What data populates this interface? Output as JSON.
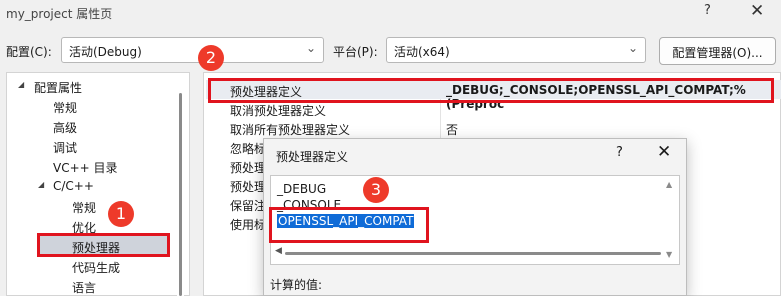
{
  "window": {
    "title": "my_project 属性页",
    "help": "?",
    "close": "✕"
  },
  "config": {
    "config_label": "配置(C):",
    "config_value": "活动(Debug)",
    "platform_label": "平台(P):",
    "platform_value": "活动(x64)",
    "manager_button": "配置管理器(O)..."
  },
  "tree": {
    "items": [
      {
        "label": "配置属性",
        "toggle": "◢"
      },
      {
        "label": "常规"
      },
      {
        "label": "高级"
      },
      {
        "label": "调试"
      },
      {
        "label": "VC++ 目录"
      },
      {
        "label": "C/C++",
        "toggle": "◢"
      },
      {
        "label": "常规"
      },
      {
        "label": "优化"
      },
      {
        "label": "预处理器"
      },
      {
        "label": "代码生成"
      },
      {
        "label": "语言"
      }
    ]
  },
  "properties": {
    "rows": [
      {
        "name": "预处理器定义",
        "value": "_DEBUG;_CONSOLE;OPENSSL_API_COMPAT;%(Preproc"
      },
      {
        "name": "取消预处理器定义",
        "value": ""
      },
      {
        "name": "取消所有预处理器定义",
        "value": "否"
      },
      {
        "name": "忽略标",
        "value": ""
      },
      {
        "name": "预处理",
        "value": ""
      },
      {
        "name": "预处理",
        "value": ""
      },
      {
        "name": "保留注",
        "value": ""
      },
      {
        "name": "使用标",
        "value": ""
      }
    ]
  },
  "dialog": {
    "title": "预处理器定义",
    "help": "?",
    "close": "✕",
    "lines": [
      "_DEBUG",
      "_CONSOLE",
      "OPENSSL_API_COMPAT"
    ],
    "computed_label": "计算的值:"
  },
  "annotations": {
    "badge1": "1",
    "badge2": "2",
    "badge3": "3",
    "color": "#e0141e"
  }
}
